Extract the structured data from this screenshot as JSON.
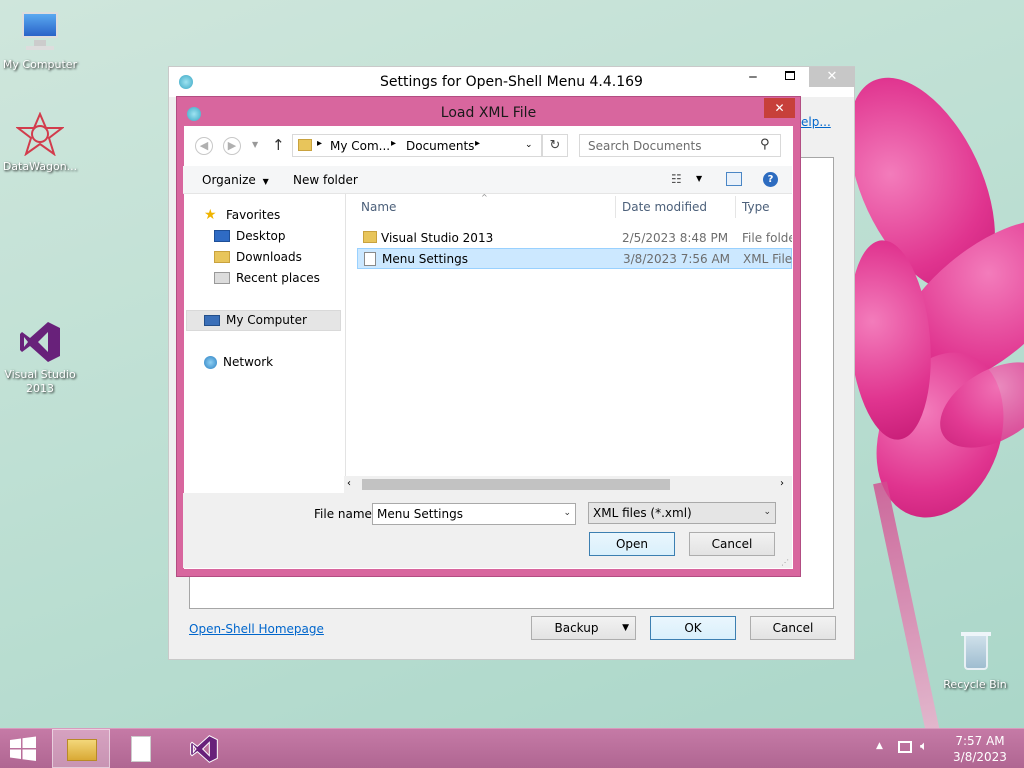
{
  "desktop": {
    "icons": [
      {
        "label": "My Computer"
      },
      {
        "label": "DataWagon..."
      },
      {
        "label": "Visual Studio 2013"
      },
      {
        "label": "Recycle Bin"
      }
    ]
  },
  "settings_window": {
    "title": "Settings for Open-Shell Menu 4.4.169",
    "help_link": "elp...",
    "homepage_link": "Open-Shell Homepage",
    "backup_label": "Backup",
    "ok_label": "OK",
    "cancel_label": "Cancel"
  },
  "dialog": {
    "title": "Load XML File",
    "close_glyph": "✕",
    "breadcrumb": [
      "My Com...",
      "Documents"
    ],
    "search_placeholder": "Search Documents",
    "toolbar": {
      "organize": "Organize",
      "new_folder": "New folder"
    },
    "nav": {
      "favorites": "Favorites",
      "favorite_items": [
        "Desktop",
        "Downloads",
        "Recent places"
      ],
      "my_computer": "My Computer",
      "network": "Network"
    },
    "columns": {
      "name": "Name",
      "date": "Date modified",
      "type": "Type"
    },
    "files": [
      {
        "name": "Visual Studio 2013",
        "date": "2/5/2023 8:48 PM",
        "type": "File folder",
        "icon": "folder-icon"
      },
      {
        "name": "Menu Settings",
        "date": "3/8/2023 7:56 AM",
        "type": "XML File",
        "icon": "document-icon",
        "selected": true
      }
    ],
    "filename_label": "File name:",
    "filename_value": "Menu Settings",
    "filetype_value": "XML files (*.xml)",
    "open_label": "Open",
    "cancel_label": "Cancel"
  },
  "taskbar": {
    "time": "7:57 AM",
    "date": "3/8/2023"
  },
  "colors": {
    "dialog_frame": "#d8669e",
    "taskbar": "#b86c98",
    "selection": "#cce8ff"
  }
}
